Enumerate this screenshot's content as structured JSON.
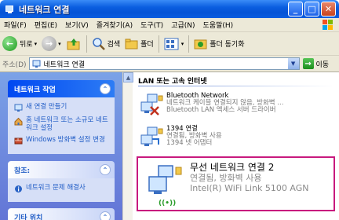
{
  "window": {
    "title": "네트워크 연결"
  },
  "menu": [
    "파일(F)",
    "편집(E)",
    "보기(V)",
    "즐겨찾기(A)",
    "도구(T)",
    "고급(N)",
    "도움말(H)"
  ],
  "toolbar": {
    "back": "뒤로",
    "search": "검색",
    "folders": "폴더",
    "folder_sync": "폴더 동기화"
  },
  "address": {
    "label": "주소(D)",
    "value": "네트워크 연결",
    "go": "이동"
  },
  "left_pane": {
    "network_tasks": {
      "title": "네트워크 작업",
      "links": [
        "새 연결 만들기",
        "홈 네트워크 또는 소규모 네트워크 설정",
        "Windows 방화벽 설정 변경"
      ]
    },
    "see_also": {
      "title": "참조:",
      "links": [
        "네트워크 문제 해결사"
      ]
    },
    "other_places": {
      "title": "기타 위치"
    }
  },
  "content": {
    "group_header": "LAN 또는 고속 인터넷",
    "items": [
      {
        "name": "Bluetooth Network",
        "status": "네트워크 케이블 연결되지 않음, 방화벽 ...",
        "device": "Bluetooth LAN 액세스 서버 드라이버"
      },
      {
        "name": "1394 연결",
        "status": "연결됨, 방화벽 사용",
        "device": "1394 넷 어댑터"
      },
      {
        "name": "무선 네트워크 연결 2",
        "status": "연결됨, 방화벽 사용",
        "device": "Intel(R) WiFi Link 5100 AGN"
      }
    ]
  },
  "colors": {
    "title_bar": "#0a5ee0",
    "left_pane": "#7ba2e7",
    "selection_outline": "#c8197e"
  }
}
